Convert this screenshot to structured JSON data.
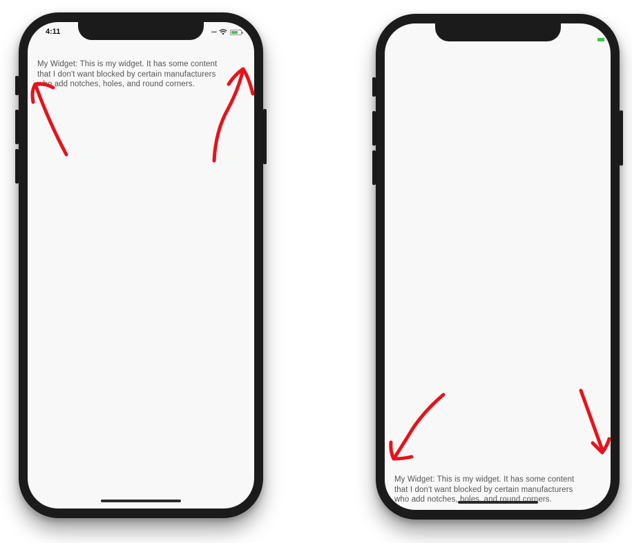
{
  "portrait": {
    "status_bar": {
      "time": "4:11",
      "signal_icon": "signal-dots-icon",
      "wifi_icon": "wifi-icon",
      "battery_icon": "battery-icon",
      "battery_color": "#3fc34a"
    },
    "widget_text": {
      "line1": "My Widget: This is my widget. It has some content",
      "line2": "that I don't want blocked by certain manufacturers",
      "line3": "who add notches, holes, and round corners."
    }
  },
  "landscape": {
    "status_bar": {
      "battery_icon": "battery-icon",
      "battery_color": "#3fc34a"
    },
    "widget_text": {
      "line1": "My Widget: This is my widget. It has some content",
      "line2": "that I don't want blocked by certain manufacturers",
      "line3": "who add notches, holes, and round corners."
    }
  },
  "annotations": {
    "arrow_color": "#e8121a",
    "arrow_icon": "hand-drawn-arrow-icon"
  }
}
